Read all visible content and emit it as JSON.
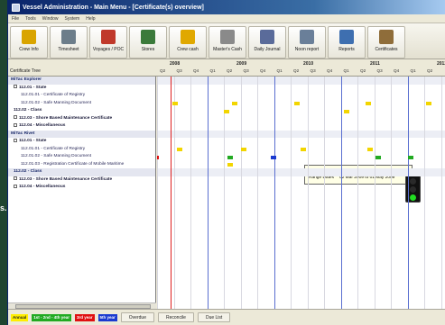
{
  "window": {
    "title": "Vessel Administration - Main Menu - [Certificate(s) overview]"
  },
  "menu": [
    "File",
    "Tools",
    "Window",
    "System",
    "Help"
  ],
  "toolbar": [
    {
      "label": "Crew Info",
      "icon": "crew-icon",
      "color": "#d9a400"
    },
    {
      "label": "Timesheet",
      "icon": "timesheet-icon",
      "color": "#6c7d8a"
    },
    {
      "label": "Voyages / POC",
      "icon": "flag-icon",
      "color": "#c0392b"
    },
    {
      "label": "Stores",
      "icon": "stores-icon",
      "color": "#3b7a3b"
    },
    {
      "label": "Crew cash",
      "icon": "cash-icon",
      "color": "#e0a800"
    },
    {
      "label": "Master's Cash",
      "icon": "coins-icon",
      "color": "#8a8a8a"
    },
    {
      "label": "Daily Journal",
      "icon": "journal-icon",
      "color": "#5a6b9a"
    },
    {
      "label": "Noon report",
      "icon": "report-icon",
      "color": "#6a7f99"
    },
    {
      "label": "Reports",
      "icon": "reports-icon",
      "color": "#3e6fb0"
    },
    {
      "label": "Certificates",
      "icon": "certificate-icon",
      "color": "#8f6d3a"
    }
  ],
  "tree": {
    "header": "Certificate Tree",
    "rows": [
      {
        "text": "MiTac Explorer",
        "kind": "grp"
      },
      {
        "text": "112.01 - State",
        "kind": "l1",
        "toggle": true
      },
      {
        "text": "112.01.01 - Certificate of Registry",
        "kind": "l2"
      },
      {
        "text": "112.01.02 - Safe Manning Document",
        "kind": "l2"
      },
      {
        "text": "112.02 - Class",
        "kind": "l1"
      },
      {
        "text": "112.03 - Shore Based Maintenance Certificate",
        "kind": "l1",
        "toggle": true
      },
      {
        "text": "112.04 - Miscellaneous",
        "kind": "l1",
        "toggle": true
      },
      {
        "text": "MiTac Rivet",
        "kind": "grp"
      },
      {
        "text": "112.01 - State",
        "kind": "l1",
        "toggle": true
      },
      {
        "text": "112.01.01 - Certificate of Registry",
        "kind": "l2"
      },
      {
        "text": "112.01.02 - Safe Manning Document",
        "kind": "l2"
      },
      {
        "text": "112.01.03 - Registration Certificate of Mobile Maritime",
        "kind": "l2"
      },
      {
        "text": "112.02 - Class",
        "kind": "l1",
        "shade": true
      },
      {
        "text": "112.03 - Shore Based Maintenance Certificate",
        "kind": "l1",
        "toggle": true
      },
      {
        "text": "112.04 - Miscellaneous",
        "kind": "l1",
        "toggle": true
      }
    ]
  },
  "timeline": {
    "years": [
      "2008",
      "2009",
      "2010",
      "2011",
      "2012"
    ],
    "quarters": [
      "Q2",
      "Q3",
      "Q4",
      "Q1",
      "Q2",
      "Q3",
      "Q4",
      "Q1",
      "Q2",
      "Q3",
      "Q4",
      "Q1",
      "Q2",
      "Q3",
      "Q4",
      "Q1",
      "Q2"
    ]
  },
  "tooltip": {
    "due_label": "Due Date",
    "due_value": "01 Apr 2009",
    "range_label": "Range Dates",
    "range_value": "02 Mar 2009 to 01 May 2009"
  },
  "status": {
    "legend": [
      {
        "text": "Annual",
        "color": "#ffee00",
        "textcolor": "#222"
      },
      {
        "text": "1st - 2nd - 4th year",
        "color": "#22aa22",
        "textcolor": "#fff"
      },
      {
        "text": "3rd year",
        "color": "#e01010",
        "textcolor": "#fff"
      },
      {
        "text": "5th year",
        "color": "#1a3ad0",
        "textcolor": "#fff"
      }
    ],
    "buttons": [
      "Overdue",
      "Reconcile",
      "Due List"
    ]
  },
  "side_label": "s."
}
